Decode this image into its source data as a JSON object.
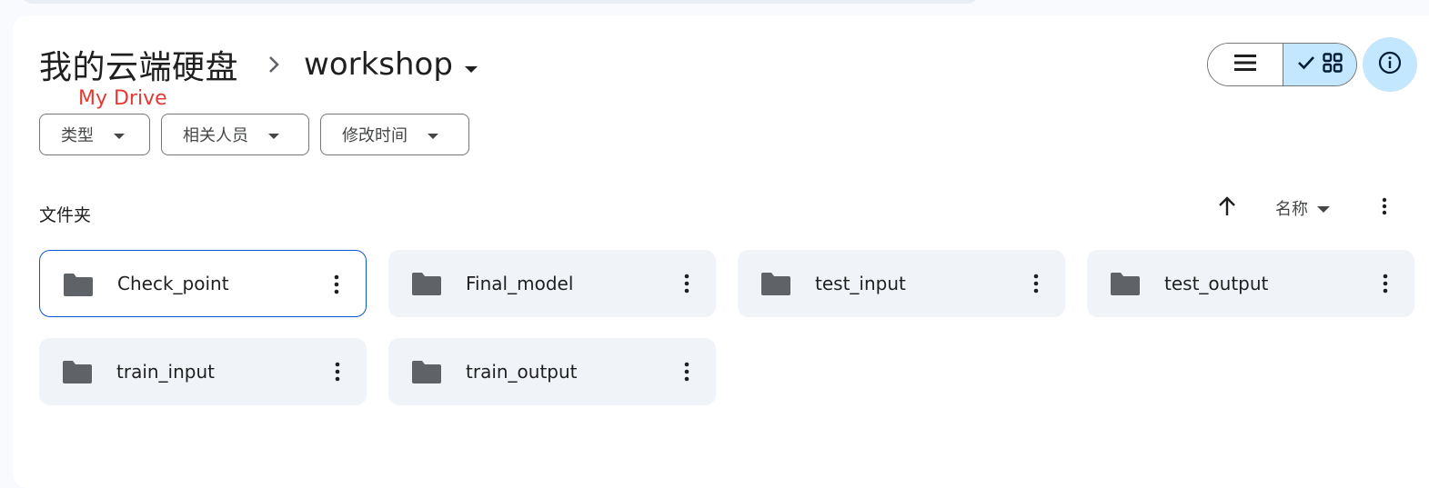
{
  "breadcrumb": {
    "root": "我的云端硬盘",
    "current": "workshop"
  },
  "annotation": "My Drive",
  "filters": [
    {
      "label": "类型"
    },
    {
      "label": "相关人员"
    },
    {
      "label": "修改时间"
    }
  ],
  "view": {
    "mode": "grid",
    "list_icon": "list-icon",
    "grid_icon": "grid-icon",
    "check_icon": "check-icon",
    "info_icon": "info-icon"
  },
  "section": {
    "title": "文件夹",
    "sort_label": "名称",
    "sort_direction": "ascending"
  },
  "folders": [
    {
      "name": "Check_point",
      "selected": true
    },
    {
      "name": "Final_model",
      "selected": false
    },
    {
      "name": "test_input",
      "selected": false
    },
    {
      "name": "test_output",
      "selected": false
    },
    {
      "name": "train_input",
      "selected": false
    },
    {
      "name": "train_output",
      "selected": false
    }
  ],
  "colors": {
    "accent": "#0b57d0",
    "selected_toggle": "#c2e7ff",
    "card_bg": "#f0f4f9",
    "annotation": "#e53935"
  }
}
